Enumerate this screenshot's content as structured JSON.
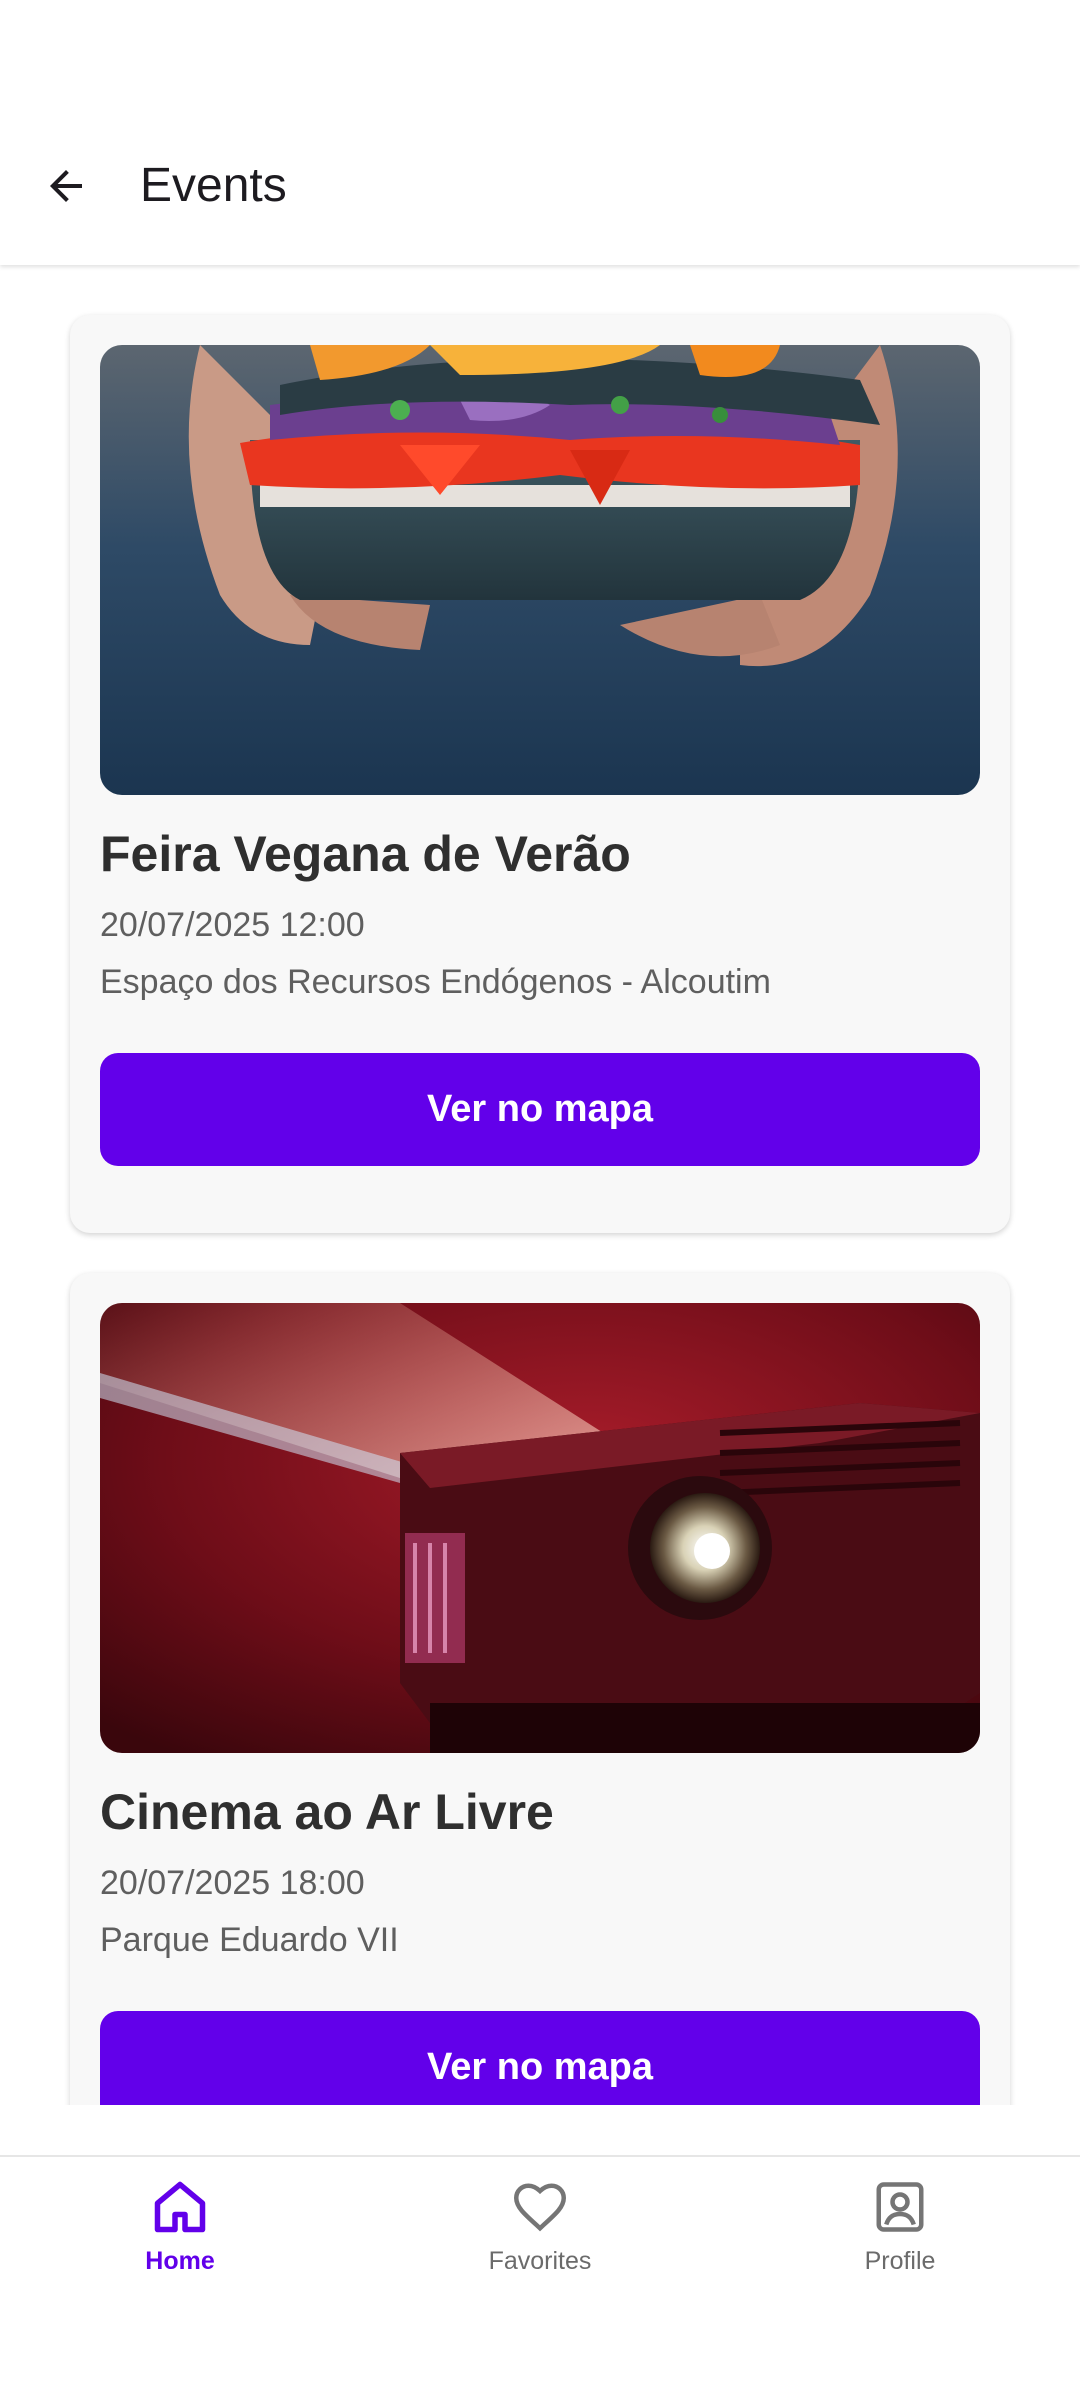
{
  "app_bar": {
    "title": "Events",
    "back_icon": "arrow-back-icon"
  },
  "events": [
    {
      "title": "Feira Vegana de Verão",
      "datetime": "20/07/2025 12:00",
      "location": "Espaço dos Recursos Endógenos - Alcoutim",
      "button_label": "Ver no mapa",
      "image": "vegan-sandwich-photo"
    },
    {
      "title": "Cinema ao Ar Livre",
      "datetime": "20/07/2025 18:00",
      "location": "Parque Eduardo VII",
      "button_label": "Ver no mapa",
      "image": "projector-photo"
    }
  ],
  "bottom_nav": {
    "items": [
      {
        "label": "Home",
        "icon": "home-icon",
        "active": true
      },
      {
        "label": "Favorites",
        "icon": "heart-icon",
        "active": false
      },
      {
        "label": "Profile",
        "icon": "profile-icon",
        "active": false
      }
    ]
  },
  "colors": {
    "accent": "#6200ea",
    "card_background": "#f8f8f8",
    "title_text": "#2f2f2f",
    "secondary_text": "#5f5f5f"
  }
}
